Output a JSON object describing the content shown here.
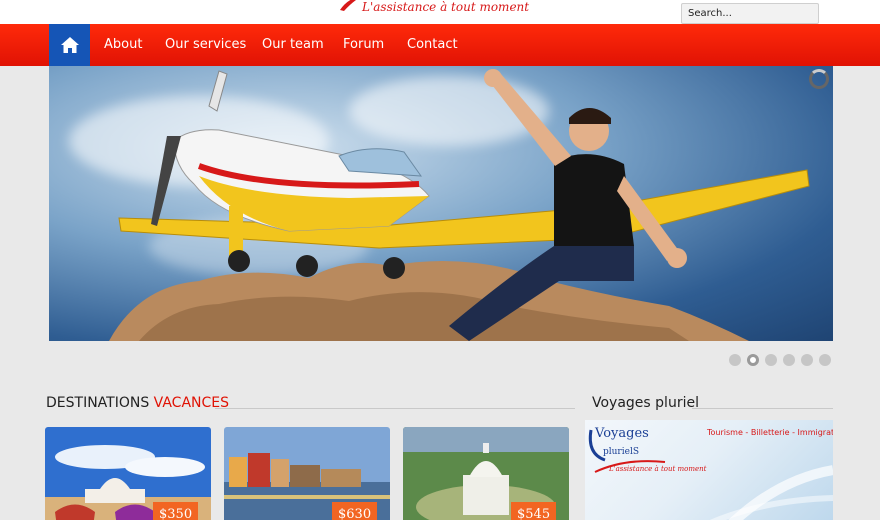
{
  "header": {
    "tagline": "L'assistance à tout moment",
    "search_placeholder": "Search..."
  },
  "nav": {
    "home_icon": "home-icon",
    "items": [
      "About",
      "Our services",
      "Our team",
      "Forum",
      "Contact"
    ]
  },
  "slider": {
    "slide_count": 6,
    "active_slide": 2
  },
  "sections": {
    "destinations": {
      "title_part1": "DESTINATIONS",
      "title_part2": "VACANCES"
    },
    "voyages": {
      "title": "Voyages pluriel"
    }
  },
  "destinations": [
    {
      "price": "$350"
    },
    {
      "price": "$630"
    },
    {
      "price": "$545"
    }
  ],
  "banner": {
    "brand": "Voyages",
    "brand_line2": "plurielS",
    "services": "Tourisme - Billetterie - Immigration",
    "tagline": "L'assistance à tout moment"
  },
  "colors": {
    "accent_red": "#e01204",
    "home_blue": "#1555b6",
    "price_orange": "#f26522"
  }
}
